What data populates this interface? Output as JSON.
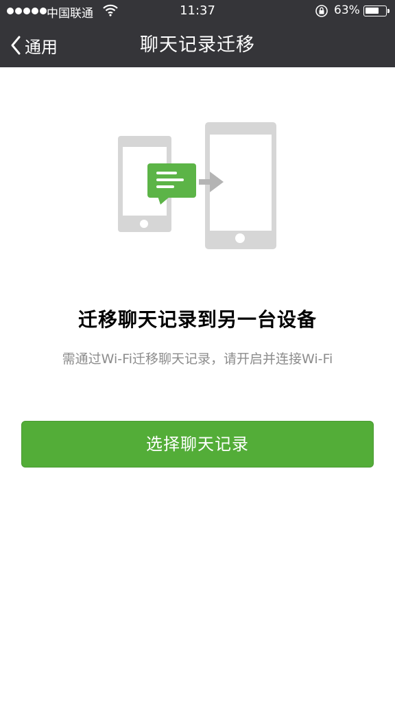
{
  "status_bar": {
    "carrier": "中国联通",
    "time": "11:37",
    "battery": "63%"
  },
  "nav": {
    "back_label": "通用",
    "title": "聊天记录迁移"
  },
  "main": {
    "headline": "迁移聊天记录到另一台设备",
    "description": "需通过Wi-Fi迁移聊天记录，请开启并连接Wi-Fi",
    "button_label": "选择聊天记录"
  },
  "colors": {
    "nav_bg": "#353539",
    "accent_green": "#53ad38",
    "device_gray": "#d6d6d6",
    "text_secondary": "#8c8c8c"
  }
}
